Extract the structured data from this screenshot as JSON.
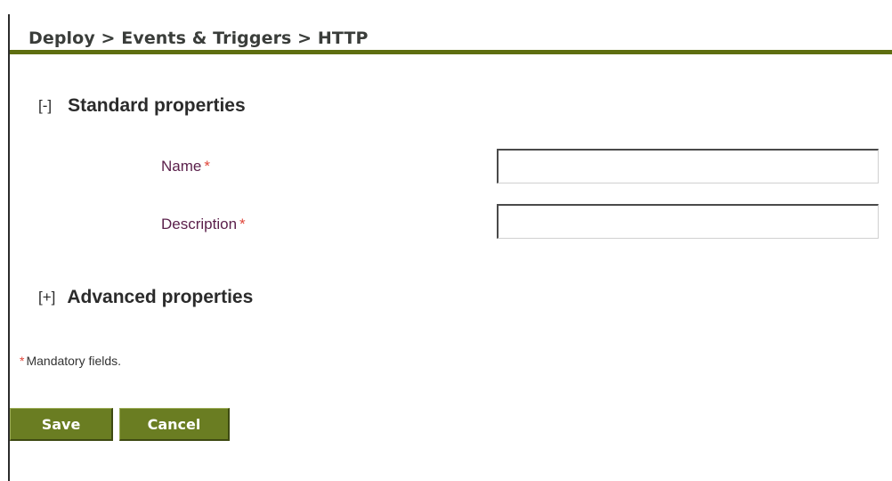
{
  "header": {
    "breadcrumb": "Deploy > Events & Triggers > HTTP"
  },
  "sections": {
    "standard": {
      "toggle": "[-]",
      "title": "Standard properties",
      "fields": {
        "name": {
          "label": "Name",
          "required_mark": "*",
          "value": ""
        },
        "description": {
          "label": "Description",
          "required_mark": "*",
          "value": ""
        }
      }
    },
    "advanced": {
      "toggle": "[+]",
      "title": "Advanced properties"
    }
  },
  "footer": {
    "required_mark": "*",
    "mandatory_note": "Mandatory fields."
  },
  "buttons": {
    "save": "Save",
    "cancel": "Cancel"
  },
  "colors": {
    "accent": "#5e6e10",
    "button_bg": "#6a7d22",
    "label_text": "#5a1f4a",
    "required": "#e0463a"
  }
}
